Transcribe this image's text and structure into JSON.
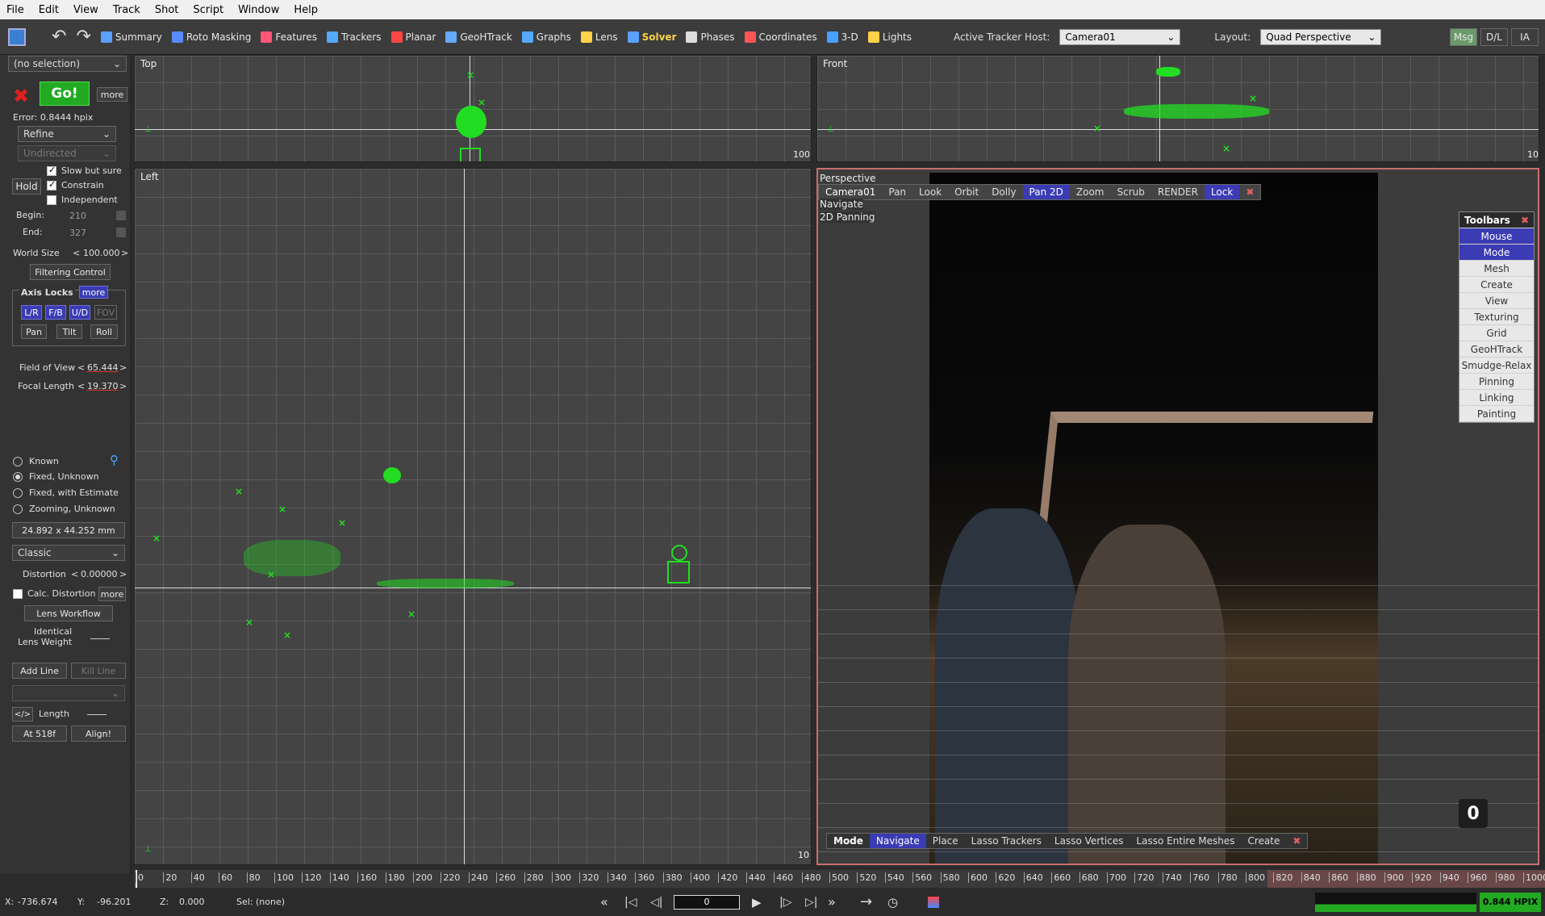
{
  "menu": [
    "File",
    "Edit",
    "View",
    "Track",
    "Shot",
    "Script",
    "Window",
    "Help"
  ],
  "toolbar": {
    "tabs": [
      {
        "label": "Summary",
        "icon": "summary-icon",
        "color": "#5aa0ff"
      },
      {
        "label": "Roto Masking",
        "icon": "roto-icon",
        "color": "#5a8aff"
      },
      {
        "label": "Features",
        "icon": "features-icon",
        "color": "#ff5577"
      },
      {
        "label": "Trackers",
        "icon": "trackers-icon",
        "color": "#55aaff"
      },
      {
        "label": "Planar",
        "icon": "planar-icon",
        "color": "#ff4444"
      },
      {
        "label": "GeoHTrack",
        "icon": "geohtrack-icon",
        "color": "#66aaff"
      },
      {
        "label": "Graphs",
        "icon": "graphs-icon",
        "color": "#55aaff"
      },
      {
        "label": "Lens",
        "icon": "lens-icon",
        "color": "#ffd24a"
      },
      {
        "label": "Solver",
        "icon": "solver-icon",
        "color": "#5aa0ff",
        "active": true
      },
      {
        "label": "Phases",
        "icon": "phases-icon",
        "color": "#dddddd"
      },
      {
        "label": "Coordinates",
        "icon": "coordinates-icon",
        "color": "#ff5555"
      },
      {
        "label": "3-D",
        "icon": "3d-icon",
        "color": "#4aa0ff"
      },
      {
        "label": "Lights",
        "icon": "lights-icon",
        "color": "#ffd24a"
      }
    ],
    "tracker_host_label": "Active Tracker Host:",
    "tracker_host_value": "Camera01",
    "layout_label": "Layout:",
    "layout_value": "Quad Perspective",
    "right_buttons": [
      "Msg",
      "D/L",
      "IA"
    ]
  },
  "left": {
    "selection": "(no selection)",
    "go": "Go!",
    "more": "more",
    "error": "Error:  0.8444 hpix",
    "refine": "Refine",
    "undirected": "Undirected",
    "hold": "Hold",
    "slow": "Slow but sure",
    "constrain": "Constrain",
    "independent": "Independent",
    "begin_label": "Begin:",
    "begin_val": "210",
    "end_label": "End:",
    "end_val": "327",
    "world_size_label": "World Size",
    "world_size_val": "100.000",
    "filtering": "Filtering Control",
    "axis_locks": "Axis Locks",
    "axis_more": "more",
    "locks": [
      "L/R",
      "F/B",
      "U/D",
      "FOV"
    ],
    "rot": [
      "Pan",
      "Tilt",
      "Roll"
    ],
    "fov_label": "Field of View",
    "fov_val": "65.444",
    "focal_label": "Focal Length",
    "focal_val": "19.370",
    "lens_modes": [
      "Known",
      "Fixed, Unknown",
      "Fixed, with Estimate",
      "Zooming, Unknown"
    ],
    "sensor": "24.892 x 44.252 mm",
    "classic": "Classic",
    "distortion_label": "Distortion",
    "distortion_val": "0.00000",
    "calc_dist": "Calc. Distortion",
    "calc_more": "more",
    "lens_workflow": "Lens Workflow",
    "identical": "Identical",
    "lens_weight": "Lens Weight",
    "add_line": "Add Line",
    "kill_line": "Kill Line",
    "code": "</>",
    "length": "Length",
    "at_frame": "At 518f",
    "align": "Align!"
  },
  "viewports": {
    "top_label": "Top",
    "top_scale": "100",
    "front_label": "Front",
    "front_scale": "10",
    "left_label": "Left",
    "left_scale": "10",
    "persp_label": "Perspective",
    "persp_camera": "Camera01",
    "persp_lines": [
      "Navigate",
      "2D Panning"
    ],
    "persp_tools": [
      "Pan",
      "Look",
      "Orbit",
      "Dolly",
      "Pan 2D",
      "Zoom",
      "Scrub",
      "RENDER",
      "Lock"
    ],
    "persp_active": [
      "Pan 2D",
      "Lock"
    ],
    "frame_badge": "0",
    "bottom_tools": [
      "Mode",
      "Navigate",
      "Place",
      "Lasso Trackers",
      "Lasso Vertices",
      "Lasso Entire Meshes",
      "Create"
    ],
    "toolbars_title": "Toolbars",
    "toolbars_items": [
      "Mouse",
      "Mode",
      "Mesh",
      "Create",
      "View",
      "Texturing",
      "Grid",
      "GeoHTrack",
      "Smudge-Relax",
      "Pinning",
      "Linking",
      "Painting"
    ]
  },
  "timeline": {
    "ticks": [
      "0",
      "20",
      "40",
      "60",
      "80",
      "100",
      "120",
      "140",
      "160",
      "180",
      "200",
      "220",
      "240",
      "260",
      "280",
      "300",
      "320",
      "340",
      "360",
      "380",
      "400",
      "420",
      "440",
      "460",
      "480",
      "500",
      "520",
      "540",
      "560",
      "580",
      "600",
      "620",
      "640",
      "660",
      "680",
      "700",
      "720",
      "740",
      "760",
      "780",
      "800",
      "820",
      "840",
      "860",
      "880",
      "900",
      "920",
      "940",
      "960",
      "980",
      "1000"
    ],
    "current_frame": "0"
  },
  "status": {
    "x_label": "X:",
    "x_val": "-736.674",
    "y_label": "Y:",
    "y_val": "-96.201",
    "z_label": "Z:",
    "z_val": "0.000",
    "sel": "Sel: (none)",
    "hpix": "0.844 HPIX"
  },
  "colors": {
    "accent": "#3b3bb4",
    "tracker": "#22dd22",
    "go": "#22aa22",
    "active_border": "#c86e6e"
  }
}
